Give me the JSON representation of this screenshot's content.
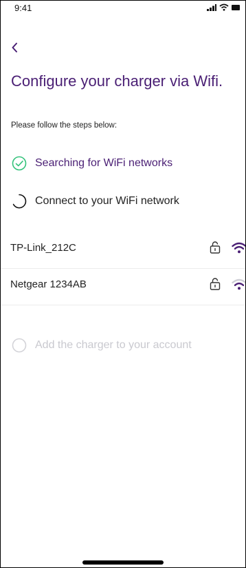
{
  "status_bar": {
    "time": "9:41"
  },
  "header": {
    "title": "Configure your charger via Wifi.",
    "subtitle": "Please follow the steps below:"
  },
  "steps": [
    {
      "label": "Searching for WiFi networks",
      "state": "completed"
    },
    {
      "label": "Connect to your WiFi network",
      "state": "in-progress"
    },
    {
      "label": "Add the charger to your account",
      "state": "pending"
    }
  ],
  "networks": [
    {
      "name": "TP-Link_212C",
      "locked": true,
      "signal": "strong"
    },
    {
      "name": "Netgear 1234AB",
      "locked": true,
      "signal": "weak"
    }
  ],
  "colors": {
    "accent": "#4a1f74",
    "success": "#32c27a",
    "disabled": "#c9c9cf",
    "text": "#222222"
  }
}
